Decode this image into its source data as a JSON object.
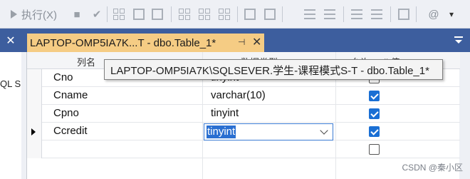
{
  "toolbar": {
    "execute_label": "执行(X)",
    "icons": [
      "execute-icon",
      "stop-icon",
      "check-icon",
      "parse-icon",
      "results-grid-icon",
      "plan-icon",
      "query-options-icon",
      "results-text-icon",
      "results-file-icon",
      "comment-icon",
      "uncomment-icon",
      "indent-icon",
      "outdent-icon",
      "specify-values-icon",
      "more-icon"
    ]
  },
  "left_panel": {
    "close_glyph": "✕",
    "partial_text": "QL S"
  },
  "tab": {
    "title": "LAPTOP-OMP5IA7K...T - dbo.Table_1*",
    "pin_glyph": "⊣",
    "close_glyph": "✕"
  },
  "grid": {
    "headers": [
      "列名",
      "数据类型",
      "允许 Null 值"
    ],
    "rows": [
      {
        "name": "Cno",
        "type": "tinyint",
        "allow_null": false,
        "current": false
      },
      {
        "name": "Cname",
        "type": "varchar(10)",
        "allow_null": true,
        "current": false
      },
      {
        "name": "Cpno",
        "type": "tinyint",
        "allow_null": true,
        "current": false
      },
      {
        "name": "Ccredit",
        "type": "tinyint",
        "allow_null": true,
        "current": true
      },
      {
        "name": "",
        "type": "",
        "allow_null": false,
        "current": false
      }
    ]
  },
  "tooltip": {
    "text": "LAPTOP-OMP5IA7K\\SQLSEVER.学生-课程模式S-T - dbo.Table_1*"
  },
  "watermark": "CSDN @秦小区",
  "colors": {
    "tab_strip": "#3d5e9e",
    "active_tab": "#f5cc84",
    "checkbox_checked": "#1a6fd4",
    "selection": "#2a6fd1"
  }
}
